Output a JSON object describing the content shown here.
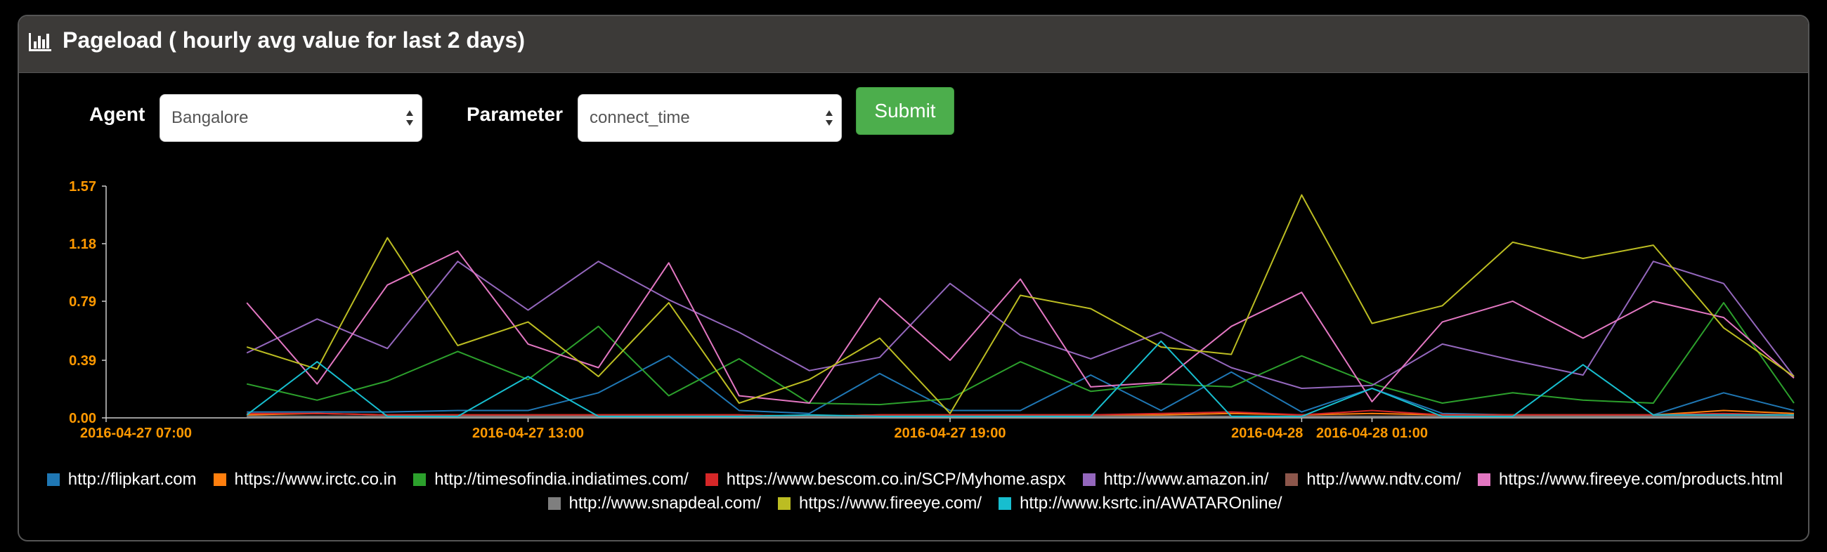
{
  "panel": {
    "title": "Pageload ( hourly avg value for last 2 days)"
  },
  "form": {
    "agent_label": "Agent",
    "agent_value": "Bangalore",
    "parameter_label": "Parameter",
    "parameter_value": "connect_time",
    "submit_label": "Submit"
  },
  "colors": {
    "header_bg": "#3c3a38",
    "tick_color": "#ff9900",
    "submit_bg": "#4cae4c"
  },
  "chart_data": {
    "type": "line",
    "title": "",
    "xlabel": "",
    "ylabel": "",
    "ylim": [
      0,
      1.57
    ],
    "yticks": [
      "0.00",
      "0.39",
      "0.79",
      "1.18",
      "1.57"
    ],
    "xlim": [
      "2016-04-27 07:00",
      "2016-04-28 07:00"
    ],
    "xticks": [
      "2016-04-27 07:00",
      "2016-04-27 13:00",
      "2016-04-27 19:00",
      "2016-04-28 01:00",
      "2016-04-28"
    ],
    "x": [
      "2016-04-27 09:00",
      "2016-04-27 10:00",
      "2016-04-27 11:00",
      "2016-04-27 12:00",
      "2016-04-27 13:00",
      "2016-04-27 14:00",
      "2016-04-27 15:00",
      "2016-04-27 16:00",
      "2016-04-27 17:00",
      "2016-04-27 18:00",
      "2016-04-27 19:00",
      "2016-04-27 20:00",
      "2016-04-27 21:00",
      "2016-04-27 22:00",
      "2016-04-27 23:00",
      "2016-04-28 00:00",
      "2016-04-28 01:00",
      "2016-04-28 02:00",
      "2016-04-28 03:00",
      "2016-04-28 04:00",
      "2016-04-28 05:00",
      "2016-04-28 06:00",
      "2016-04-28 07:00"
    ],
    "series": [
      {
        "name": "http://flipkart.com",
        "color": "#1f77b4",
        "values": [
          0.04,
          0.04,
          0.04,
          0.05,
          0.05,
          0.17,
          0.42,
          0.05,
          0.03,
          0.3,
          0.05,
          0.05,
          0.29,
          0.05,
          0.31,
          0.04,
          0.2,
          0.03,
          0.02,
          0.02,
          0.02,
          0.17,
          0.05
        ]
      },
      {
        "name": "https://www.irctc.co.in",
        "color": "#ff7f0e",
        "values": [
          0.02,
          0.03,
          0.02,
          0.02,
          0.02,
          0.02,
          0.02,
          0.02,
          0.01,
          0.02,
          0.02,
          0.02,
          0.02,
          0.02,
          0.03,
          0.02,
          0.03,
          0.02,
          0.02,
          0.02,
          0.02,
          0.05,
          0.03
        ]
      },
      {
        "name": "http://timesofindia.indiatimes.com/",
        "color": "#2ca02c",
        "values": [
          0.23,
          0.12,
          0.25,
          0.45,
          0.26,
          0.62,
          0.15,
          0.4,
          0.1,
          0.09,
          0.13,
          0.38,
          0.18,
          0.23,
          0.21,
          0.42,
          0.23,
          0.1,
          0.17,
          0.12,
          0.1,
          0.78,
          0.1
        ]
      },
      {
        "name": "https://www.bescom.co.in/SCP/Myhome.aspx",
        "color": "#d62728",
        "values": [
          0.03,
          0.03,
          0.02,
          0.02,
          0.02,
          0.02,
          0.02,
          0.02,
          0.01,
          0.02,
          0.02,
          0.02,
          0.02,
          0.03,
          0.04,
          0.02,
          0.05,
          0.02,
          0.02,
          0.02,
          0.02,
          0.03,
          0.02
        ]
      },
      {
        "name": "http://www.amazon.in/",
        "color": "#9467bd",
        "values": [
          0.44,
          0.67,
          0.47,
          1.06,
          0.73,
          1.06,
          0.8,
          0.58,
          0.32,
          0.41,
          0.91,
          0.56,
          0.4,
          0.58,
          0.34,
          0.2,
          0.22,
          0.5,
          0.39,
          0.29,
          1.06,
          0.91,
          0.28
        ]
      },
      {
        "name": "http://www.ndtv.com/",
        "color": "#8c564b",
        "values": [
          0.01,
          0.01,
          0.01,
          0.01,
          0.01,
          0.01,
          0.01,
          0.01,
          0.01,
          0.01,
          0.01,
          0.01,
          0.01,
          0.01,
          0.01,
          0.01,
          0.01,
          0.01,
          0.01,
          0.01,
          0.01,
          0.01,
          0.01
        ]
      },
      {
        "name": "https://www.fireeye.com/products.html",
        "color": "#e377c2",
        "values": [
          0.78,
          0.23,
          0.9,
          1.13,
          0.5,
          0.34,
          1.05,
          0.15,
          0.1,
          0.81,
          0.39,
          0.94,
          0.21,
          0.24,
          0.62,
          0.85,
          0.11,
          0.65,
          0.79,
          0.54,
          0.79,
          0.68,
          0.27
        ]
      },
      {
        "name": "http://www.snapdeal.com/",
        "color": "#7f7f7f",
        "values": [
          0.01,
          0.01,
          0.01,
          0.01,
          0.01,
          0.01,
          0.01,
          0.01,
          0.01,
          0.01,
          0.01,
          0.01,
          0.01,
          0.01,
          0.01,
          0.01,
          0.01,
          0.01,
          0.01,
          0.01,
          0.01,
          0.01,
          0.01
        ]
      },
      {
        "name": "https://www.fireeye.com/",
        "color": "#bcbd22",
        "values": [
          0.48,
          0.33,
          1.22,
          0.49,
          0.65,
          0.28,
          0.78,
          0.1,
          0.26,
          0.54,
          0.03,
          0.83,
          0.74,
          0.48,
          0.43,
          1.51,
          0.64,
          0.76,
          1.19,
          1.08,
          1.17,
          0.61,
          0.28
        ]
      },
      {
        "name": "http://www.ksrtc.in/AWATAROnline/",
        "color": "#17becf",
        "values": [
          0.02,
          0.38,
          0.01,
          0.01,
          0.28,
          0.01,
          0.01,
          0.01,
          0.02,
          0.01,
          0.01,
          0.01,
          0.01,
          0.52,
          0.01,
          0.01,
          0.2,
          0.01,
          0.01,
          0.36,
          0.02,
          0.02,
          0.02
        ]
      }
    ]
  }
}
